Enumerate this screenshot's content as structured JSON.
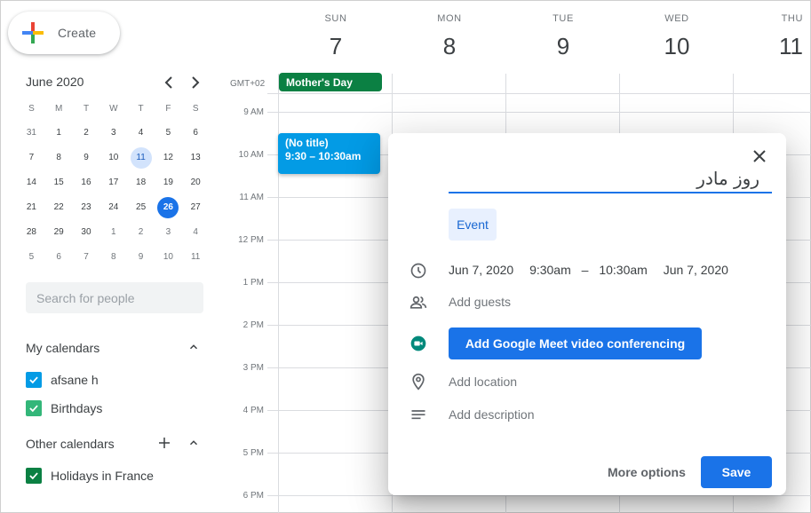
{
  "create": {
    "label": "Create"
  },
  "mini_calendar": {
    "title": "June 2020",
    "weekdays": [
      "S",
      "M",
      "T",
      "W",
      "T",
      "F",
      "S"
    ],
    "weeks": [
      [
        {
          "d": "31",
          "other": true
        },
        {
          "d": "1"
        },
        {
          "d": "2"
        },
        {
          "d": "3"
        },
        {
          "d": "4"
        },
        {
          "d": "5"
        },
        {
          "d": "6"
        }
      ],
      [
        {
          "d": "7"
        },
        {
          "d": "8"
        },
        {
          "d": "9"
        },
        {
          "d": "10"
        },
        {
          "d": "11",
          "selected": true
        },
        {
          "d": "12"
        },
        {
          "d": "13"
        }
      ],
      [
        {
          "d": "14"
        },
        {
          "d": "15"
        },
        {
          "d": "16"
        },
        {
          "d": "17"
        },
        {
          "d": "18"
        },
        {
          "d": "19"
        },
        {
          "d": "20"
        }
      ],
      [
        {
          "d": "21"
        },
        {
          "d": "22"
        },
        {
          "d": "23"
        },
        {
          "d": "24"
        },
        {
          "d": "25"
        },
        {
          "d": "26",
          "today": true
        },
        {
          "d": "27"
        }
      ],
      [
        {
          "d": "28"
        },
        {
          "d": "29"
        },
        {
          "d": "30"
        },
        {
          "d": "1",
          "other": true
        },
        {
          "d": "2",
          "other": true
        },
        {
          "d": "3",
          "other": true
        },
        {
          "d": "4",
          "other": true
        }
      ],
      [
        {
          "d": "5",
          "other": true
        },
        {
          "d": "6",
          "other": true
        },
        {
          "d": "7",
          "other": true
        },
        {
          "d": "8",
          "other": true
        },
        {
          "d": "9",
          "other": true
        },
        {
          "d": "10",
          "other": true
        },
        {
          "d": "11",
          "other": true
        }
      ]
    ]
  },
  "search_people": {
    "placeholder": "Search for people"
  },
  "my_calendars": {
    "title": "My calendars",
    "items": [
      {
        "label": "afsane h",
        "color": "#039be5"
      },
      {
        "label": "Birthdays",
        "color": "#33b679"
      }
    ]
  },
  "other_calendars": {
    "title": "Other calendars",
    "items": [
      {
        "label": "Holidays in France",
        "color": "#0b8043"
      }
    ]
  },
  "week": {
    "days": [
      {
        "dow": "SUN",
        "num": "7"
      },
      {
        "dow": "MON",
        "num": "8"
      },
      {
        "dow": "TUE",
        "num": "9"
      },
      {
        "dow": "WED",
        "num": "10"
      },
      {
        "dow": "THU",
        "num": "11"
      }
    ],
    "timezone": "GMT+02",
    "hours": [
      "9 AM",
      "10 AM",
      "11 AM",
      "12 PM",
      "1 PM",
      "2 PM",
      "3 PM",
      "4 PM",
      "5 PM",
      "6 PM"
    ]
  },
  "events": {
    "allday": {
      "title": "Mother's Day",
      "color": "#0b8043"
    },
    "timed": {
      "title": "(No title)",
      "time": "9:30 – 10:30am",
      "color": "#039be5"
    }
  },
  "dialog": {
    "title_value": "روز مادر",
    "type_chip": "Event",
    "start_date": "Jun 7, 2020",
    "start_time": "9:30am",
    "dash": "–",
    "end_time": "10:30am",
    "end_date": "Jun 7, 2020",
    "add_guests": "Add guests",
    "meet_button": "Add Google Meet video conferencing",
    "add_location": "Add location",
    "add_description": "Add description",
    "more_options": "More options",
    "save": "Save"
  },
  "colors": {
    "accent": "#1a73e8"
  }
}
